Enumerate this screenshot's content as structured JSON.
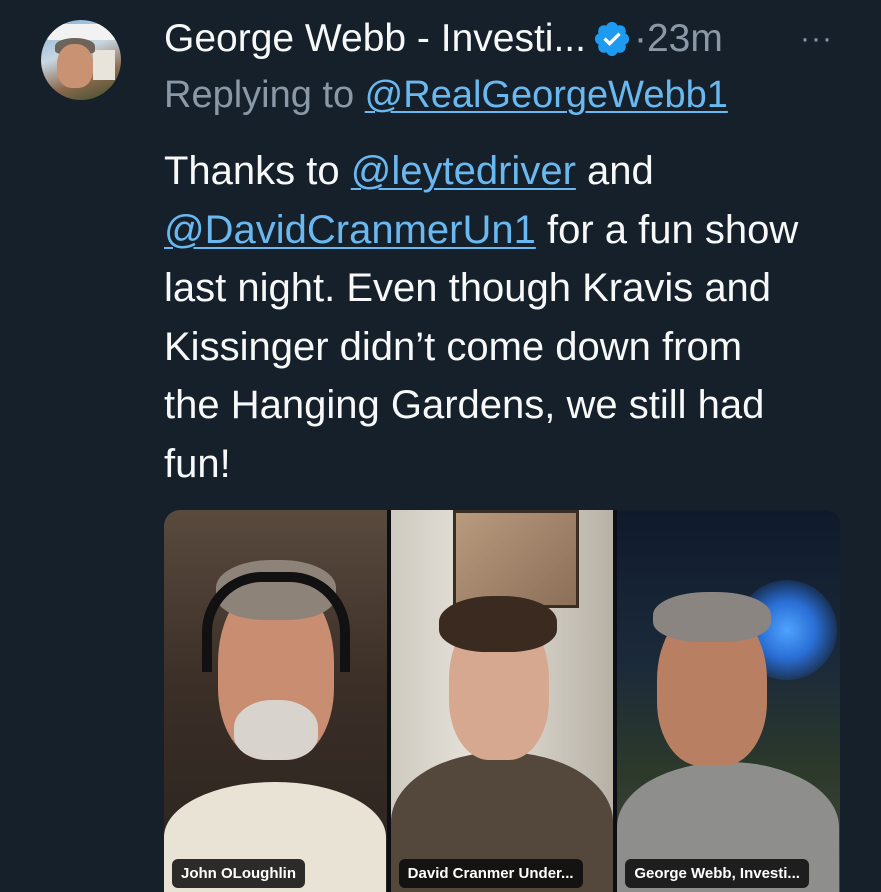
{
  "author": {
    "display_name": "George Webb - Investi...",
    "time": "·23m",
    "more_label": "···",
    "colors": {
      "verified": "#1d9bf0",
      "link": "#6ab8f0",
      "muted": "#8b98a5",
      "background": "#15202b"
    }
  },
  "reply": {
    "prefix": "Replying to ",
    "handle": "@RealGeorgeWebb1"
  },
  "body": {
    "l1_pre": "Thanks to ",
    "l1_mention": "@leytedriver",
    "l1_post": " and",
    "l2_mention": "@DavidCranmerUn1",
    "l2_post": " for a fun show",
    "l3": "last night. Even though Kravis and",
    "l4": "Kissinger didn’t come down from",
    "l5": "the Hanging Gardens, we still had",
    "l6": "fun!"
  },
  "media": {
    "panels": [
      {
        "name_label": "John OLoughlin"
      },
      {
        "name_label": "David Cranmer Under..."
      },
      {
        "name_label": "George Webb, Investi..."
      }
    ]
  },
  "icons": {
    "verified": "verified-badge-icon",
    "more": "more-horizontal-icon"
  }
}
